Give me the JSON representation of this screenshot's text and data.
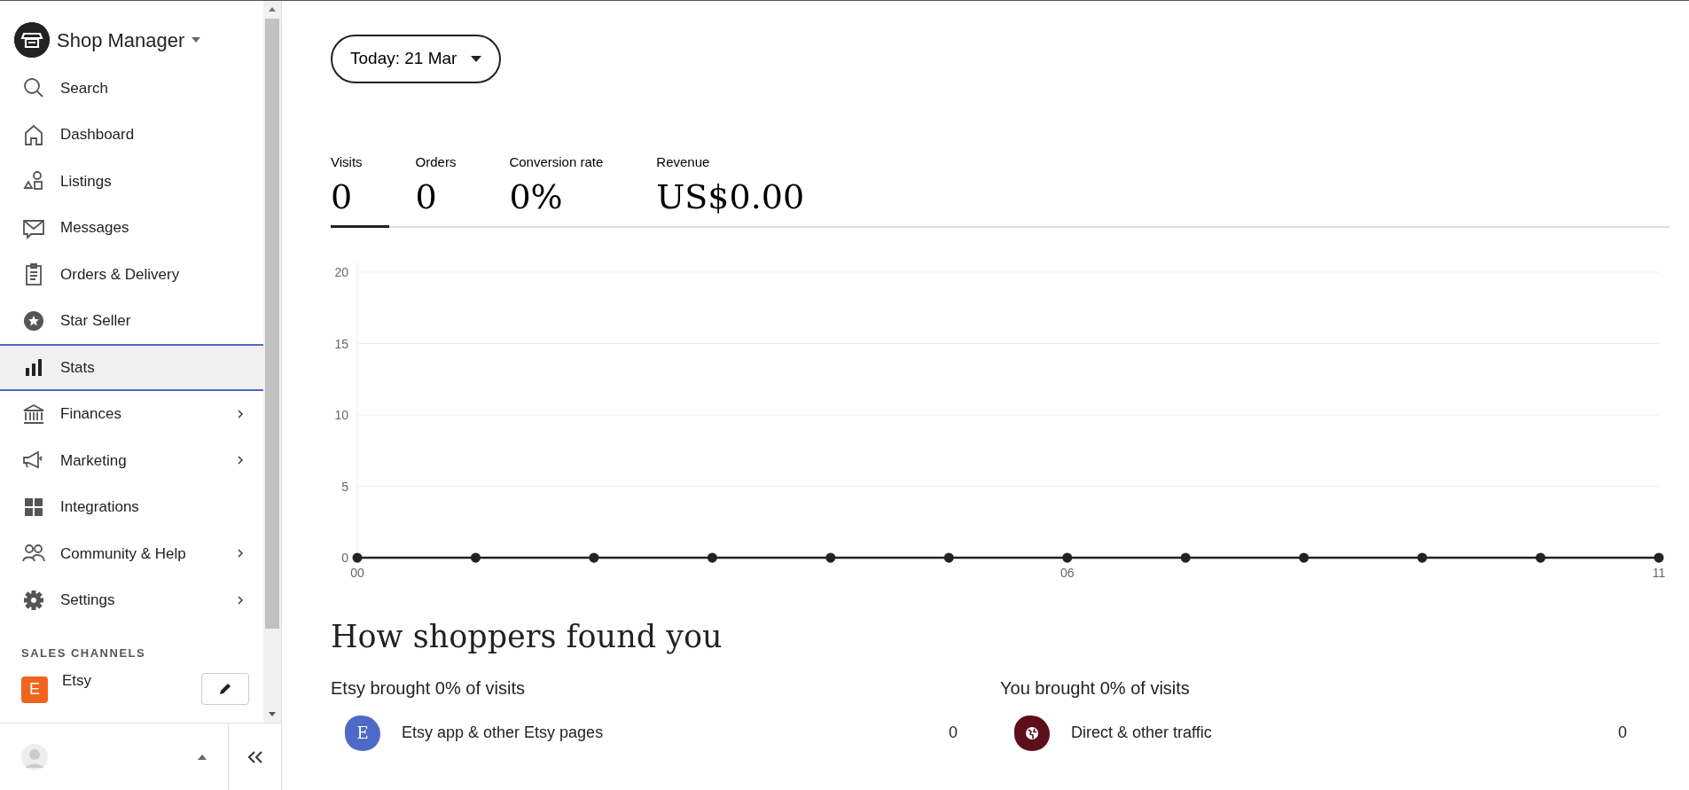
{
  "sidebar": {
    "title": "Shop Manager",
    "items": [
      {
        "label": "Search",
        "selected": false,
        "expandable": false
      },
      {
        "label": "Dashboard",
        "selected": false,
        "expandable": false
      },
      {
        "label": "Listings",
        "selected": false,
        "expandable": false
      },
      {
        "label": "Messages",
        "selected": false,
        "expandable": false
      },
      {
        "label": "Orders & Delivery",
        "selected": false,
        "expandable": false
      },
      {
        "label": "Star Seller",
        "selected": false,
        "expandable": false
      },
      {
        "label": "Stats",
        "selected": true,
        "expandable": false
      },
      {
        "label": "Finances",
        "selected": false,
        "expandable": true
      },
      {
        "label": "Marketing",
        "selected": false,
        "expandable": true
      },
      {
        "label": "Integrations",
        "selected": false,
        "expandable": false
      },
      {
        "label": "Community & Help",
        "selected": false,
        "expandable": true
      },
      {
        "label": "Settings",
        "selected": false,
        "expandable": true
      }
    ],
    "section_title": "SALES CHANNELS",
    "channels": [
      {
        "badge": "E",
        "label": "Etsy",
        "color": "#f1641e"
      }
    ]
  },
  "date_button": {
    "label": "Today: 21 Mar"
  },
  "stat_tabs": [
    {
      "label": "Visits",
      "value": "0",
      "selected": true
    },
    {
      "label": "Orders",
      "value": "0",
      "selected": false
    },
    {
      "label": "Conversion rate",
      "value": "0%",
      "selected": false
    },
    {
      "label": "Revenue",
      "value": "US$0.00",
      "selected": false
    }
  ],
  "chart": {
    "chart_data": {
      "type": "line",
      "x": [
        0,
        1,
        2,
        3,
        4,
        5,
        6,
        7,
        8,
        9,
        10,
        11
      ],
      "series": [
        {
          "color": "#222222",
          "marker": true,
          "values": [
            0,
            0,
            0,
            0,
            0,
            0,
            0,
            0,
            0,
            0,
            0,
            0
          ]
        }
      ],
      "grid": true,
      "xlim": [
        0,
        11
      ],
      "ylim": [
        0,
        20
      ],
      "yticks": [
        0,
        5,
        10,
        15,
        20
      ],
      "xticks": [
        {
          "value": 0,
          "label": "00"
        },
        {
          "value": 6,
          "label": "06"
        },
        {
          "value": 11,
          "label": "11"
        }
      ]
    }
  },
  "traffic": {
    "title": "How shoppers found you",
    "columns": [
      {
        "heading": "Etsy brought 0% of visits",
        "rows": [
          {
            "kind": "letter",
            "badge": "E",
            "color": "#4d6bc6",
            "label": "Etsy app & other Etsy pages",
            "value": "0"
          }
        ]
      },
      {
        "heading": "You brought 0% of visits",
        "rows": [
          {
            "kind": "globe",
            "color": "#5c0f1a",
            "label": "Direct & other traffic",
            "value": "0"
          }
        ]
      }
    ]
  }
}
